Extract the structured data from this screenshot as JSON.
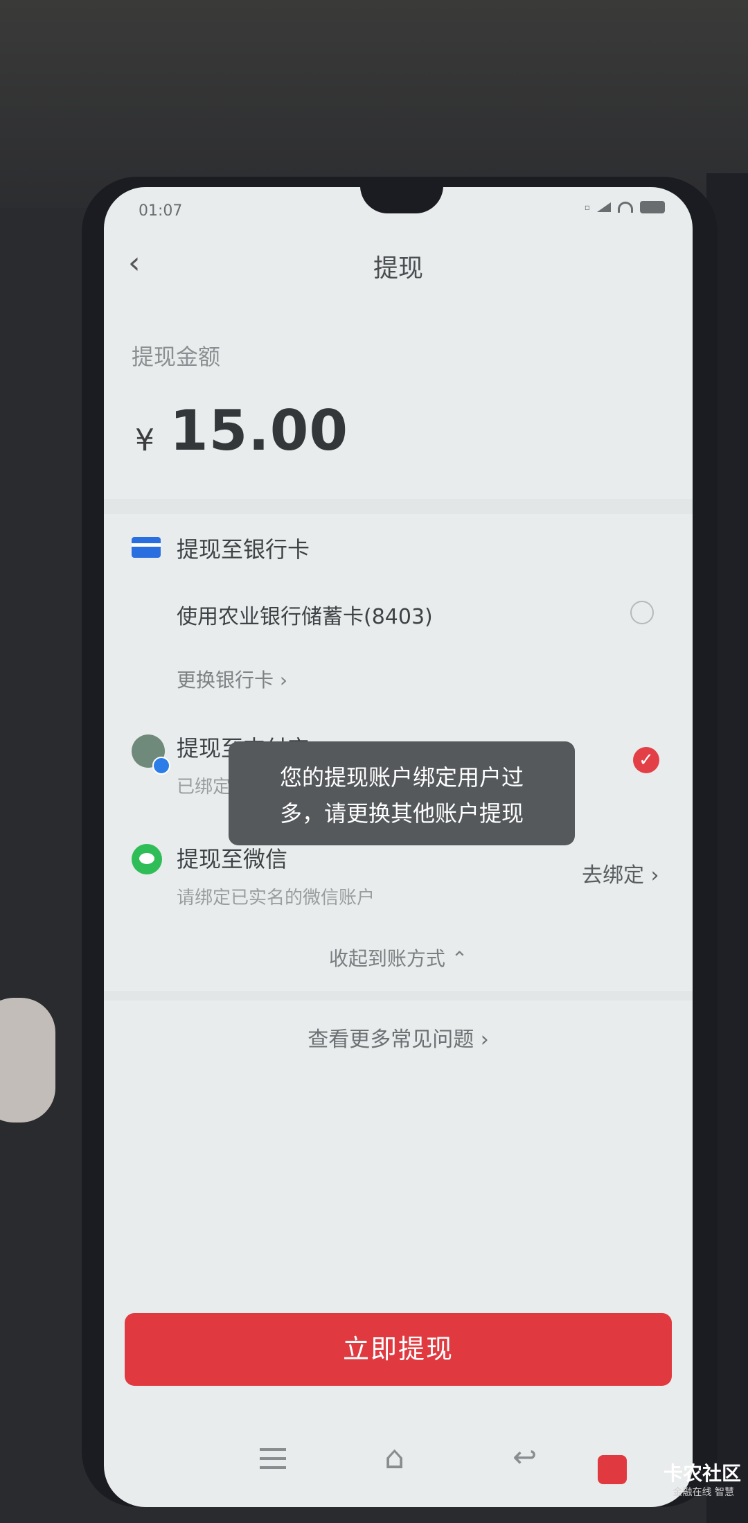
{
  "status_bar": {
    "time": "01:07"
  },
  "header": {
    "back_glyph": "‹",
    "title": "提现"
  },
  "amount": {
    "label": "提现金额",
    "currency": "¥",
    "value": "15.00"
  },
  "methods": {
    "bank": {
      "title": "提现至银行卡",
      "card": "使用农业银行储蓄卡(8403)",
      "change": "更换银行卡 ›"
    },
    "alipay": {
      "title": "提现至支付宝",
      "sub": "已绑定：15"
    },
    "wechat": {
      "title": "提现至微信",
      "sub": "请绑定已实名的微信账户",
      "action": "去绑定 ›"
    }
  },
  "toast": {
    "line1": "您的提现账户绑定用户过",
    "line2": "多，请更换其他账户提现"
  },
  "collapse_label": "收起到账方式 ⌃",
  "faq_label": "查看更多常见问题 ›",
  "withdraw_button": "立即提现",
  "watermark": {
    "title": "卡农社区",
    "sub": "金融在线 智慧"
  },
  "colors": {
    "accent": "#e0393f",
    "bank_icon": "#2a6fe0",
    "wechat": "#2fbd57"
  }
}
